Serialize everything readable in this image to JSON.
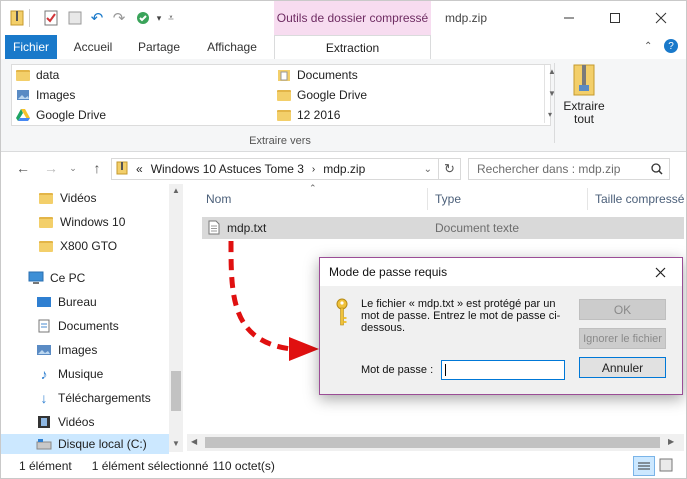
{
  "window": {
    "context_tab": "Outils de dossier compressé",
    "title": "mdp.zip"
  },
  "ribbon_tabs": {
    "file": "Fichier",
    "home": "Accueil",
    "share": "Partage",
    "view": "Affichage",
    "extract": "Extraction"
  },
  "ribbon": {
    "destinations": [
      {
        "label": "data",
        "icon": "folder-icon"
      },
      {
        "label": "Documents",
        "icon": "documents-folder-icon"
      },
      {
        "label": "Images",
        "icon": "images-folder-icon"
      },
      {
        "label": "Google Drive",
        "icon": "folder-icon"
      },
      {
        "label": "Google Drive",
        "icon": "google-drive-icon"
      },
      {
        "label": "12 2016",
        "icon": "folder-icon"
      }
    ],
    "group_label": "Extraire vers",
    "extract_all_line1": "Extraire",
    "extract_all_line2": "tout"
  },
  "address": {
    "prefix": "«",
    "crumb1": "Windows 10 Astuces Tome 3",
    "crumb2": "mdp.zip",
    "search_placeholder": "Rechercher dans : mdp.zip"
  },
  "nav_pane": {
    "items": [
      {
        "label": "Vidéos"
      },
      {
        "label": "Windows 10"
      },
      {
        "label": "X800 GTO"
      },
      {
        "label": "Ce PC"
      },
      {
        "label": "Bureau"
      },
      {
        "label": "Documents"
      },
      {
        "label": "Images"
      },
      {
        "label": "Musique"
      },
      {
        "label": "Téléchargements"
      },
      {
        "label": "Vidéos"
      },
      {
        "label": "Disque local (C:)"
      }
    ]
  },
  "file_list": {
    "columns": {
      "name": "Nom",
      "type": "Type",
      "compressed_size": "Taille compressé"
    },
    "rows": [
      {
        "name": "mdp.txt",
        "type": "Document texte"
      }
    ]
  },
  "status": {
    "count": "1 élément",
    "selection": "1 élément sélectionné",
    "size": "110 octet(s)"
  },
  "dialog": {
    "title": "Mode de passe requis",
    "message": "Le fichier « mdp.txt » est protégé par un mot de passe. Entrez le mot de passe ci-dessous.",
    "password_label": "Mot de passe :",
    "password_value": "",
    "ok": "OK",
    "skip": "Ignorer le fichier",
    "cancel": "Annuler"
  },
  "colors": {
    "file_tab": "#1979ca",
    "context_tab_bg": "#f7dcf0",
    "dialog_border": "#9b4d96",
    "arrow": "#e01010",
    "selection": "#cce8ff"
  }
}
